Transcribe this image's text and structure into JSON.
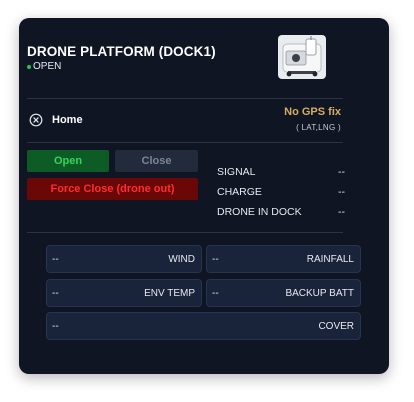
{
  "dock": {
    "title": "DRONE PLATFORM (DOCK1)",
    "status_text": "OPEN",
    "status_color": "#23c552",
    "image_icon": "dock-station-image"
  },
  "home": {
    "icon": "crosshair-close-icon",
    "label": "Home",
    "gps_status": "No GPS fix",
    "coords": "( LAT,LNG )"
  },
  "controls": {
    "open_label": "Open",
    "close_label": "Close",
    "force_close_label": "Force Close (drone out)"
  },
  "stats": [
    {
      "label": "SIGNAL",
      "value": "--"
    },
    {
      "label": "CHARGE",
      "value": "--"
    },
    {
      "label": "DRONE IN DOCK",
      "value": "--"
    }
  ],
  "metrics": {
    "wind": {
      "label": "WIND",
      "value": "--"
    },
    "rainfall": {
      "label": "RAINFALL",
      "value": "--"
    },
    "env_temp": {
      "label": "ENV TEMP",
      "value": "--"
    },
    "backup_batt": {
      "label": "BACKUP BATT",
      "value": "--"
    },
    "cover": {
      "label": "COVER",
      "value": "--"
    }
  },
  "colors": {
    "card_bg": "#0f1523",
    "gps_warning": "#d4ad62",
    "open_bg": "#0d5c25",
    "force_bg": "#6a0808"
  }
}
